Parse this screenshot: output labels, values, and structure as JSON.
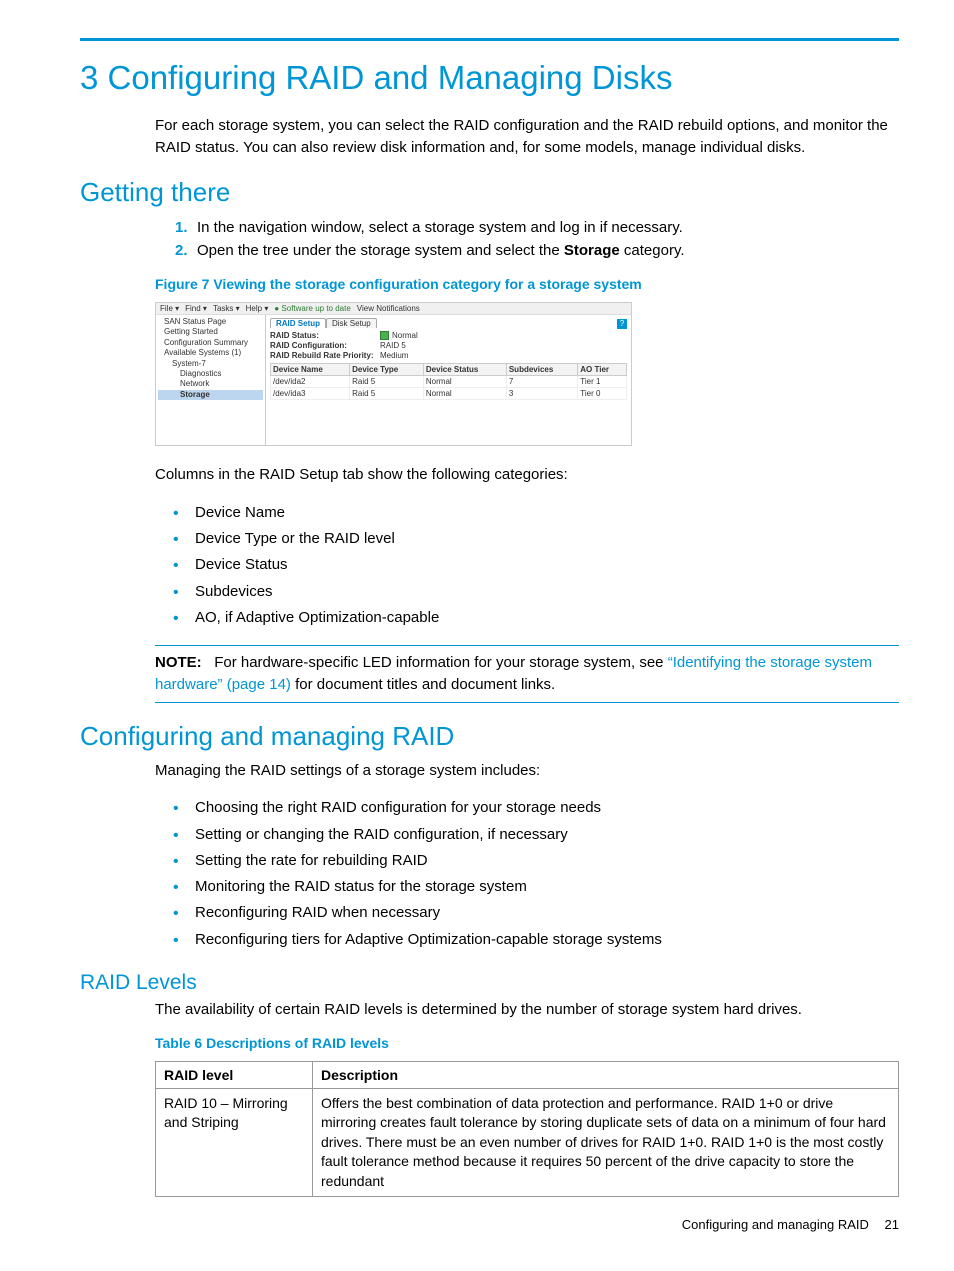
{
  "chapter": {
    "title": "3 Configuring RAID and Managing Disks",
    "intro": "For each storage system, you can select the RAID configuration and the RAID rebuild options, and monitor the RAID status. You can also review disk information and, for some models, manage individual disks."
  },
  "getting_there": {
    "heading": "Getting there",
    "steps": [
      "In the navigation window, select a storage system and log in if necessary.",
      "Open the tree under the storage system and select the Storage category."
    ],
    "step_strong_word": "Storage"
  },
  "figure": {
    "caption": "Figure 7 Viewing the storage configuration category for a storage system",
    "menubar": [
      "File ▾",
      "Find ▾",
      "Tasks ▾",
      "Help ▾",
      "Software up to date",
      "View Notifications"
    ],
    "tree": [
      {
        "label": "SAN Status Page",
        "indent": 1
      },
      {
        "label": "Getting Started",
        "indent": 1
      },
      {
        "label": "Configuration Summary",
        "indent": 1
      },
      {
        "label": "Available Systems (1)",
        "indent": 1
      },
      {
        "label": "System-7",
        "indent": 2
      },
      {
        "label": "Diagnostics",
        "indent": 3
      },
      {
        "label": "Network",
        "indent": 3
      },
      {
        "label": "Storage",
        "indent": 3,
        "selected": true
      }
    ],
    "tabs": {
      "active": "RAID Setup",
      "other": "Disk Setup"
    },
    "kv": [
      {
        "k": "RAID Status:",
        "v": "Normal",
        "status": true
      },
      {
        "k": "RAID Configuration:",
        "v": "RAID 5"
      },
      {
        "k": "RAID Rebuild Rate Priority:",
        "v": "Medium"
      }
    ],
    "table": {
      "headers": [
        "Device Name",
        "Device Type",
        "Device Status",
        "Subdevices",
        "AO Tier"
      ],
      "rows": [
        [
          "/dev/ida2",
          "Raid 5",
          "Normal",
          "7",
          "Tier 1"
        ],
        [
          "/dev/ida3",
          "Raid 5",
          "Normal",
          "3",
          "Tier 0"
        ]
      ]
    },
    "help_icon": "?"
  },
  "columns_intro": "Columns in the RAID Setup tab show the following categories:",
  "columns_list": [
    "Device Name",
    "Device Type or the RAID level",
    "Device Status",
    "Subdevices",
    "AO, if Adaptive Optimization-capable"
  ],
  "note": {
    "label": "NOTE:",
    "text_before_link": "For hardware-specific LED information for your storage system, see ",
    "link": "“Identifying the storage system hardware” (page 14)",
    "text_after_link": " for document titles and document links."
  },
  "managing": {
    "heading": "Configuring and managing RAID",
    "intro": "Managing the RAID settings of a storage system includes:",
    "items": [
      "Choosing the right RAID configuration for your storage needs",
      "Setting or changing the RAID configuration, if necessary",
      "Setting the rate for rebuilding RAID",
      "Monitoring the RAID status for the storage system",
      "Reconfiguring RAID when necessary",
      "Reconfiguring tiers for Adaptive Optimization-capable storage systems"
    ]
  },
  "raid_levels": {
    "heading": "RAID Levels",
    "intro": "The availability of certain RAID levels is determined by the number of storage system hard drives.",
    "table_caption": "Table 6 Descriptions of RAID levels",
    "headers": [
      "RAID level",
      "Description"
    ],
    "rows": [
      {
        "level": "RAID 10 – Mirroring and Striping",
        "desc": "Offers the best combination of data protection and performance. RAID 1+0 or drive mirroring creates fault tolerance by storing duplicate sets of data on a minimum of four hard drives. There must be an even number of drives for RAID 1+0. RAID 1+0 is the most costly fault tolerance method because it requires 50 percent of the drive capacity to store the redundant"
      }
    ]
  },
  "footer": {
    "text": "Configuring and managing RAID",
    "page": "21"
  }
}
